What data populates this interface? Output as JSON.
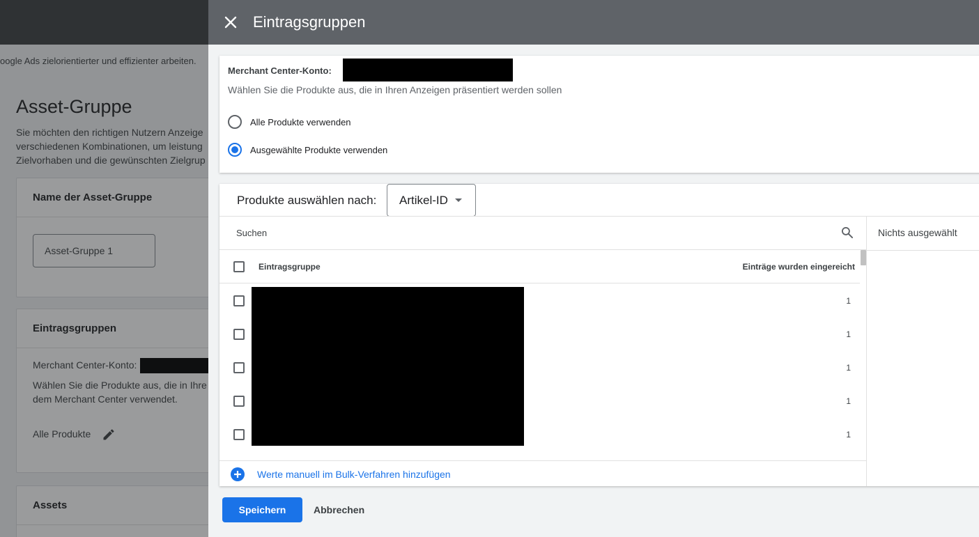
{
  "background": {
    "banner_text": "oogle Ads zielorientierter und effizienter arbeiten.",
    "page_title": "Asset-Gruppe",
    "description_lines": [
      "Sie möchten den richtigen Nutzern Anzeige",
      "verschiedenen Kombinationen, um leistung",
      "Zielvorhaben und die gewünschten Zielgrup"
    ],
    "name_card": {
      "title": "Name der Asset-Gruppe",
      "input_value": "Asset-Gruppe 1"
    },
    "listing_card": {
      "title": "Eintragsgruppen",
      "merchant_label": "Merchant Center-Konto:",
      "desc_line1": "Wählen Sie die Produkte aus, die in Ihre",
      "desc_line2": "dem Merchant Center verwendet.",
      "products_label": "Alle Produkte"
    },
    "assets_card": {
      "title": "Assets"
    }
  },
  "drawer": {
    "title": "Eintragsgruppen",
    "merchant_label": "Merchant Center-Konto:",
    "subtitle": "Wählen Sie die Produkte aus, die in Ihren Anzeigen präsentiert werden sollen",
    "radio_options": [
      {
        "label": "Alle Produkte verwenden",
        "checked": false
      },
      {
        "label": "Ausgewählte Produkte verwenden",
        "checked": true
      }
    ],
    "select_by_label": "Produkte auswählen nach:",
    "select_by_value": "Artikel-ID",
    "search_placeholder": "Suchen",
    "columns": {
      "name": "Eintragsgruppe",
      "count": "Einträge wurden eingereicht"
    },
    "rows": [
      {
        "count": "1"
      },
      {
        "count": "1"
      },
      {
        "count": "1"
      },
      {
        "count": "1"
      },
      {
        "count": "1"
      }
    ],
    "bulk_add_label": "Werte manuell im Bulk-Verfahren hinzufügen",
    "selected_panel_text": "Nichts ausgewählt",
    "save_label": "Speichern",
    "cancel_label": "Abbrechen"
  },
  "colors": {
    "accent": "#1a73e8",
    "header": "#5f6368",
    "topbar": "#3c4043"
  }
}
